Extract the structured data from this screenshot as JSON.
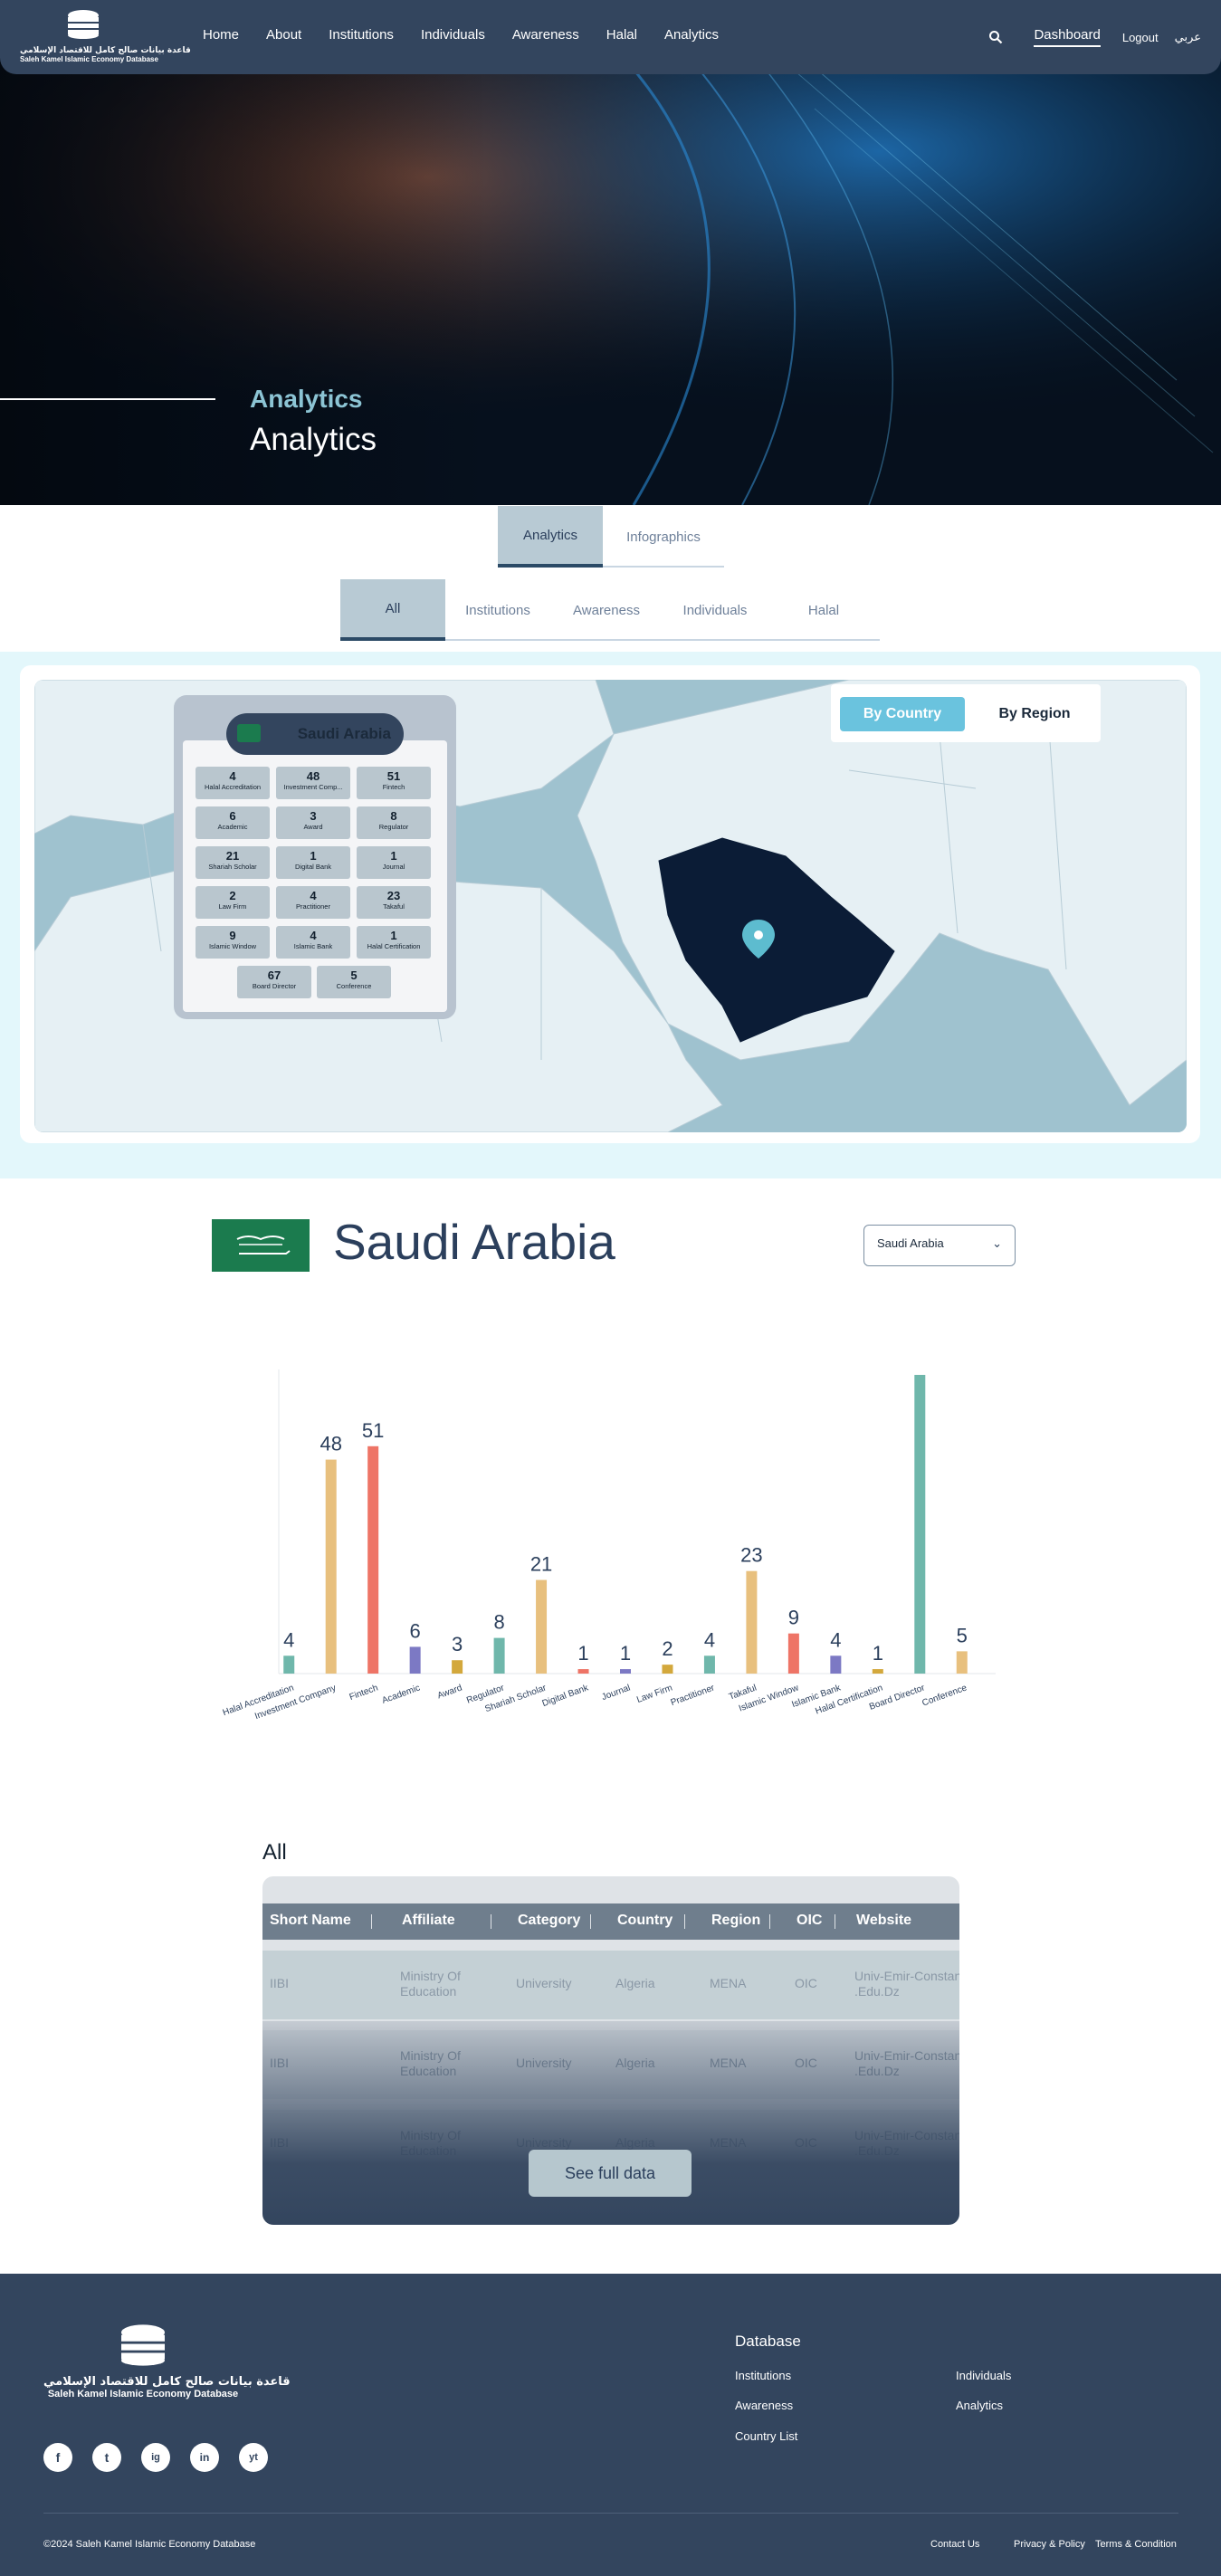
{
  "header": {
    "logo_ar": "قاعدة بيانات صالح كامل للاقتصاد الإسلامي",
    "logo_en": "Saleh Kamel Islamic Economy Database",
    "nav": [
      "Home",
      "About",
      "Institutions",
      "Individuals",
      "Awareness",
      "Halal",
      "Analytics"
    ],
    "dashboard": "Dashboard",
    "logout": "Logout",
    "lang": "عربي"
  },
  "hero": {
    "eyebrow": "Analytics",
    "title": "Analytics"
  },
  "main_tabs": [
    "Analytics",
    "Infographics"
  ],
  "sub_tabs": [
    "All",
    "Institutions",
    "Awareness",
    "Individuals",
    "Halal"
  ],
  "map": {
    "by_country": "By Country",
    "by_region": "By Region",
    "popup_title": "Saudi Arabia",
    "stats": [
      {
        "n": "4",
        "l": "Halal Accreditation"
      },
      {
        "n": "48",
        "l": "Investment Comp..."
      },
      {
        "n": "51",
        "l": "Fintech"
      },
      {
        "n": "6",
        "l": "Academic"
      },
      {
        "n": "3",
        "l": "Award"
      },
      {
        "n": "8",
        "l": "Regulator"
      },
      {
        "n": "21",
        "l": "Shariah Scholar"
      },
      {
        "n": "1",
        "l": "Digital Bank"
      },
      {
        "n": "1",
        "l": "Journal"
      },
      {
        "n": "2",
        "l": "Law Firm"
      },
      {
        "n": "4",
        "l": "Practitioner"
      },
      {
        "n": "23",
        "l": "Takaful"
      },
      {
        "n": "9",
        "l": "Islamic Window"
      },
      {
        "n": "4",
        "l": "Islamic Bank"
      },
      {
        "n": "1",
        "l": "Halal Certification"
      },
      {
        "n": "67",
        "l": "Board Director"
      },
      {
        "n": "5",
        "l": "Conference"
      }
    ]
  },
  "country": {
    "title": "Saudi Arabia",
    "select_value": "Saudi Arabia"
  },
  "chart_data": {
    "type": "bar",
    "categories": [
      "Halal Accreditation",
      "Investment Company",
      "Fintech",
      "Academic",
      "Award",
      "Regulator",
      "Shariah Scholar",
      "Digital Bank",
      "Journal",
      "Law Firm",
      "Practitioner",
      "Takaful",
      "Islamic Window",
      "Islamic Bank",
      "Halal Certification",
      "Board Director",
      "Conference"
    ],
    "values": [
      4,
      48,
      51,
      6,
      3,
      8,
      21,
      1,
      1,
      2,
      4,
      23,
      9,
      4,
      1,
      67,
      5
    ],
    "labels": [
      "4",
      "48",
      "51",
      "6",
      "3",
      "8",
      "21",
      "1",
      "1",
      "2",
      "4",
      "23",
      "9",
      "4",
      "1",
      "",
      "5"
    ],
    "colors": [
      "#6fb7ab",
      "#e8c07e",
      "#ee7466",
      "#7c79c4",
      "#d3a83c",
      "#6fb7ab",
      "#e8c07e",
      "#ee7466",
      "#7c79c4",
      "#d3a83c",
      "#6fb7ab",
      "#e8c07e",
      "#ee7466",
      "#7c79c4",
      "#d3a83c",
      "#6fb7ab",
      "#e8c07e"
    ],
    "ylim": [
      0,
      67
    ],
    "grid": false,
    "xlabel": "",
    "ylabel": ""
  },
  "table": {
    "label": "All",
    "headers": [
      "Short Name",
      "Affiliate",
      "Category",
      "Country",
      "Region",
      "OIC",
      "Website"
    ],
    "rows": [
      [
        "IIBI",
        "Ministry Of Education",
        "University",
        "Algeria",
        "MENA",
        "OIC",
        "Univ-Emir-Constan .Edu.Dz"
      ],
      [
        "IIBI",
        "Ministry Of Education",
        "University",
        "Algeria",
        "MENA",
        "OIC",
        "Univ-Emir-Constan .Edu.Dz"
      ],
      [
        "IIBI",
        "Ministry Of Education",
        "University",
        "Algeria",
        "MENA",
        "OIC",
        "Univ-Emir-Constan .Edu.Dz"
      ]
    ],
    "see_full": "See full data"
  },
  "footer": {
    "heading": "Database",
    "links": [
      "Institutions",
      "Individuals",
      "Awareness",
      "Analytics",
      "Country List"
    ],
    "social": [
      "f",
      "t",
      "ig",
      "in",
      "yt"
    ],
    "copyright": "©2024 Saleh Kamel Islamic Economy Database",
    "contact": "Contact Us",
    "privacy": "Privacy & Policy",
    "terms": "Terms & Condition"
  }
}
